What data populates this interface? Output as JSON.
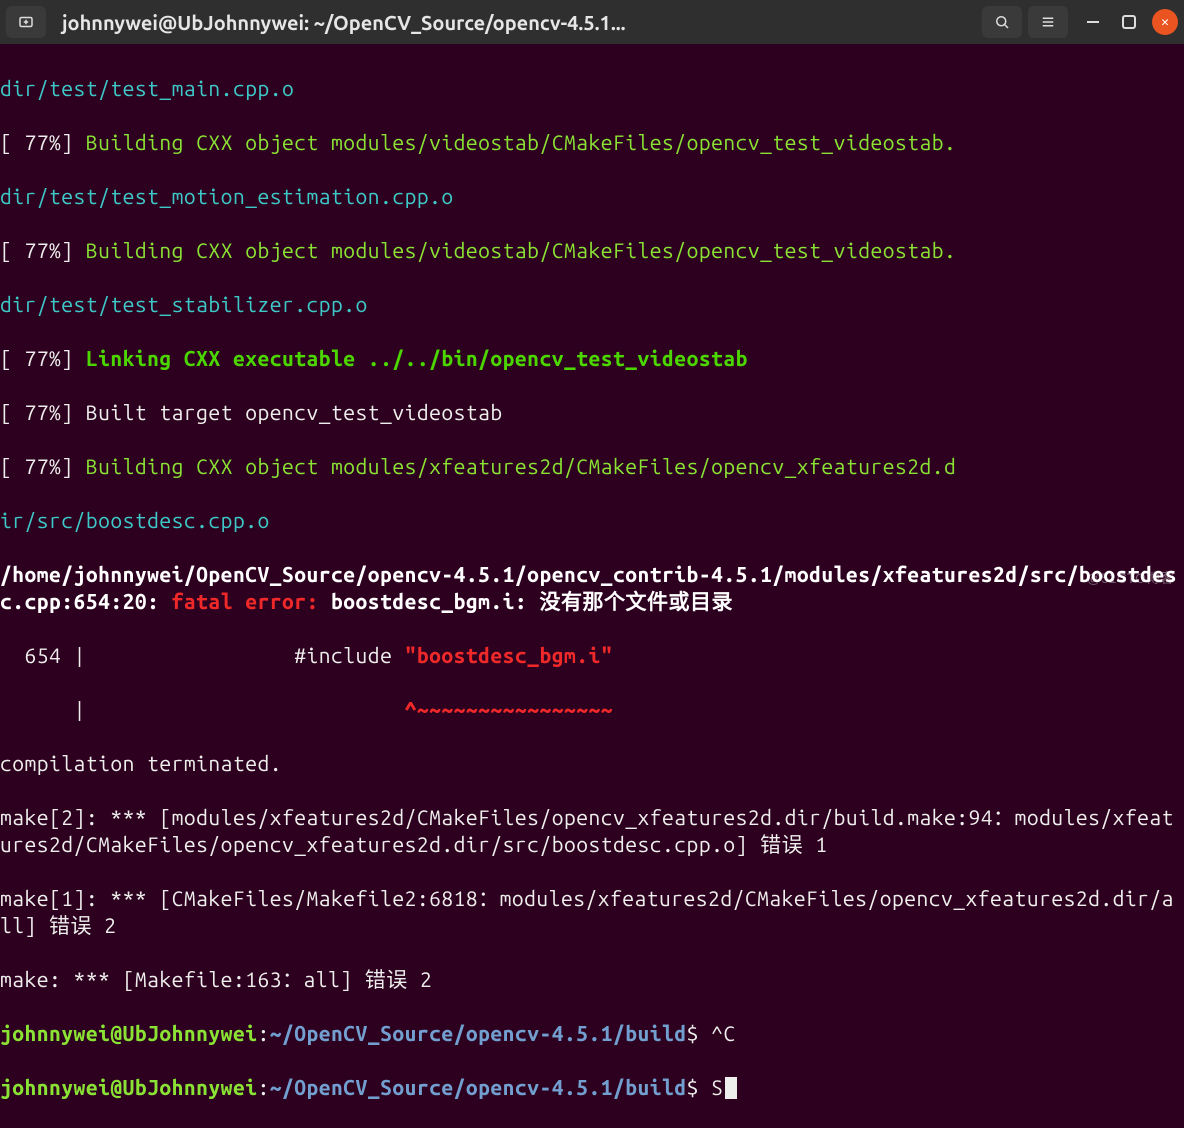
{
  "titlebar": {
    "title": "johnnywei@UbJohnnywei: ~/OpenCV_Source/opencv-4.5.1..."
  },
  "icons": {
    "newtab": "newtab-icon",
    "search": "search-icon",
    "menu": "hamburger-icon",
    "minimize": "minimize-icon",
    "maximize": "maximize-icon",
    "close": "close-icon"
  },
  "lines": {
    "l01": "dir/test/test_main.cpp.o",
    "l02a": "[ 77%] ",
    "l02b": "Building CXX object modules/videostab/CMakeFiles/opencv_test_videostab.",
    "l03": "dir/test/test_motion_estimation.cpp.o",
    "l04a": "[ 77%] ",
    "l04b": "Building CXX object modules/videostab/CMakeFiles/opencv_test_videostab.",
    "l05": "dir/test/test_stabilizer.cpp.o",
    "l06a": "[ 77%] ",
    "l06b": "Linking CXX executable ../../bin/opencv_test_videostab",
    "l07a": "[ 77%] ",
    "l07b": "Built target opencv_test_videostab",
    "l08a": "[ 77%] ",
    "l08b": "Building CXX object modules/xfeatures2d/CMakeFiles/opencv_xfeatures2d.d",
    "l09": "ir/src/boostdesc.cpp.o",
    "l10": "/home/johnnywei/OpenCV_Source/opencv-4.5.1/opencv_contrib-4.5.1/modules/xfeatures2d/src/boostdesc.cpp:654:20:",
    "l10err": " fatal error: ",
    "l10rest": "boostdesc_bgm.i: 没有那个文件或目录",
    "l11a": "  654 |                 #include ",
    "l11b": "\"boostdesc_bgm.i\"",
    "l12": "      |                          ",
    "l12b": "^~~~~~~~~~~~~~~~~",
    "l13": "compilation terminated.",
    "l14": "make[2]: *** [modules/xfeatures2d/CMakeFiles/opencv_xfeatures2d.dir/build.make:94：modules/xfeatures2d/CMakeFiles/opencv_xfeatures2d.dir/src/boostdesc.cpp.o] 错误 1",
    "l15": "make[1]: *** [CMakeFiles/Makefile2:6818：modules/xfeatures2d/CMakeFiles/opencv_xfeatures2d.dir/all] 错误 2",
    "l16": "make: *** [Makefile:163：all] 错误 2",
    "prompt_user": "johnnywei@UbJohnnywei",
    "prompt_sep": ":",
    "prompt_path": "~/OpenCV_Source/opencv-4.5.1/build",
    "prompt_dollar": "$ ",
    "cmd1": "^C",
    "cmd2": "S"
  },
  "watermark": "@51CTO博客"
}
